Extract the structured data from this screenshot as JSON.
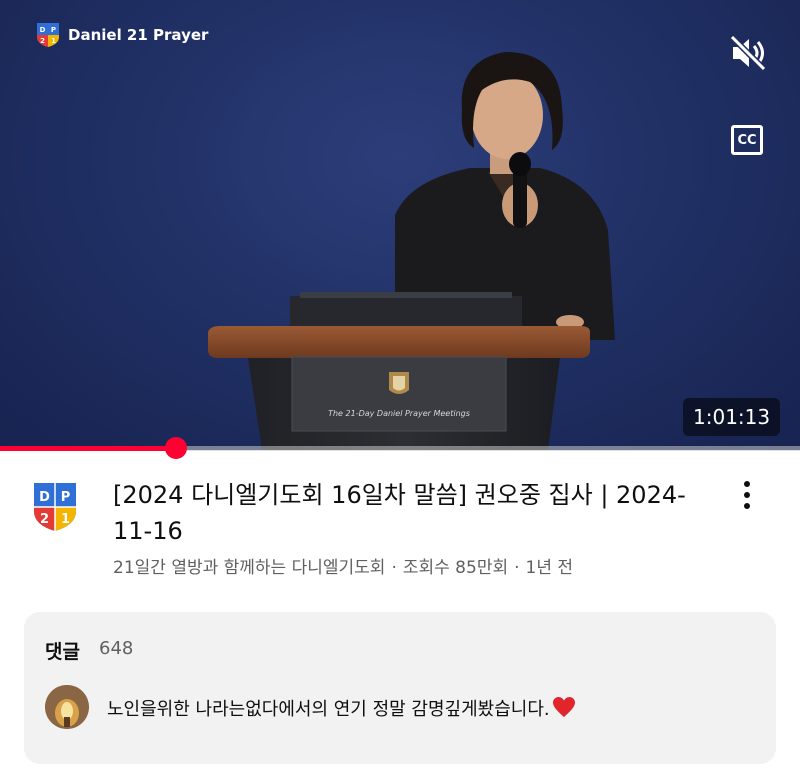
{
  "player": {
    "channel_watermark": "Daniel 21 Prayer",
    "logo_letters": [
      "D",
      "P",
      "2",
      "1"
    ],
    "podium_text": "The 21-Day Daniel Prayer Meetings",
    "duration": "1:01:13",
    "progress_fraction": 0.22,
    "mute_icon": "muted-speaker-icon",
    "cc_label": "CC",
    "accent_color": "#ff0033"
  },
  "video": {
    "title": "[2024 다니엘기도회 16일차 말씀] 권오중 집사 | 2024-11-16",
    "channel_name": "21일간 열방과 함께하는 다니엘기도회",
    "views": "조회수 85만회",
    "age": "1년 전",
    "separator": "·"
  },
  "comments": {
    "label": "댓글",
    "count": "648",
    "top_comment": "노인을위한 나라는없다에서의 연기 정말 감명깊게봤습니다.",
    "heart_icon": "red-heart-icon"
  }
}
